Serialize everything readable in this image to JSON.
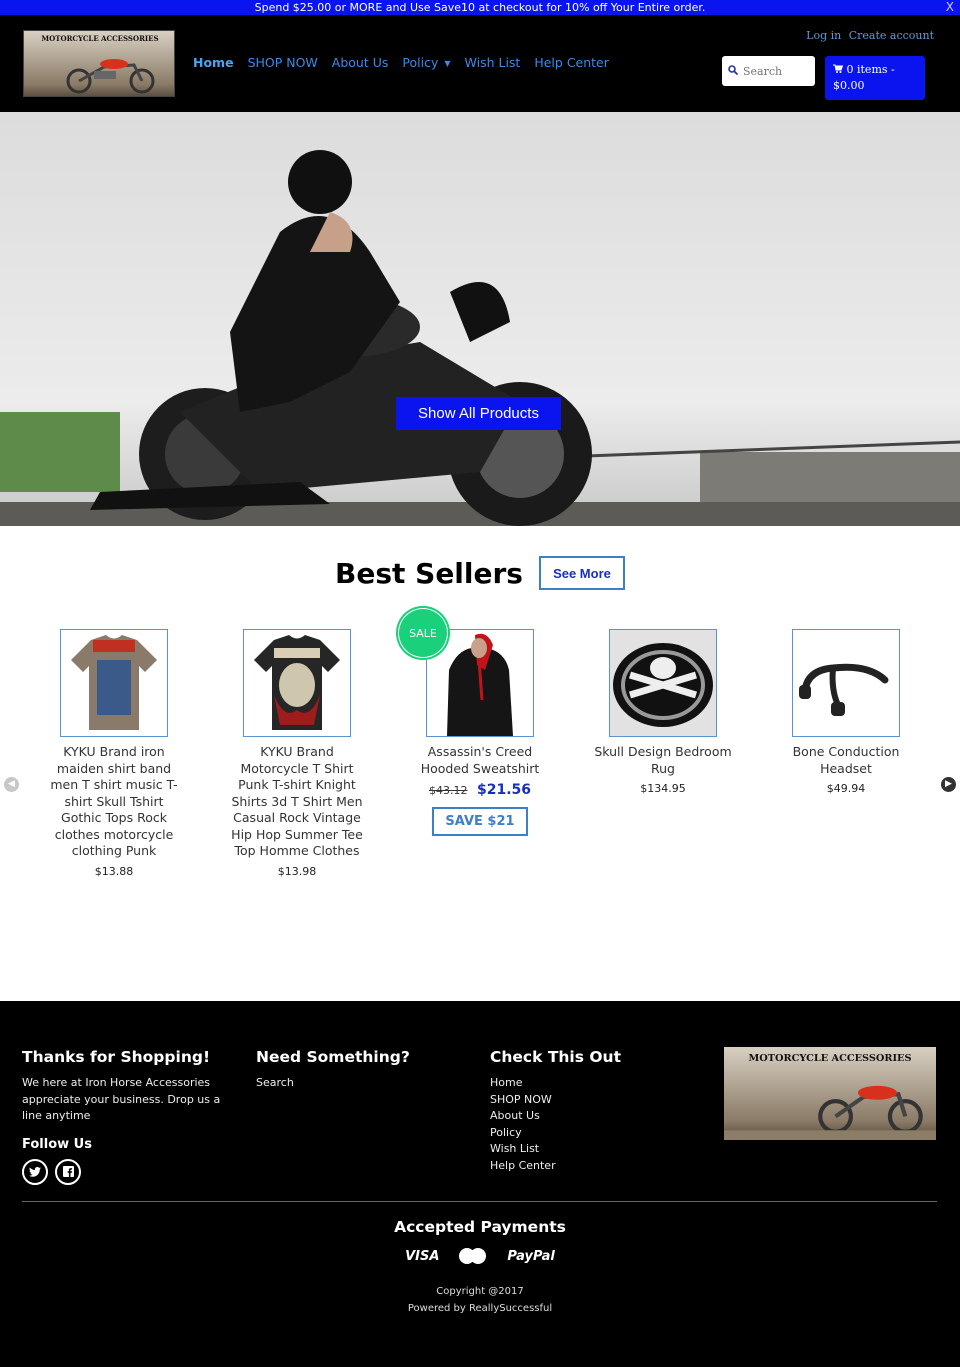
{
  "announcement": {
    "text": "Spend $25.00 or MORE and Use Save10 at checkout for 10% off Your Entire order.",
    "close": "X"
  },
  "header": {
    "logo_text": "Motorcycle Accessories",
    "nav": [
      {
        "label": "Home",
        "active": true
      },
      {
        "label": "SHOP NOW"
      },
      {
        "label": "About Us"
      },
      {
        "label": "Policy",
        "dropdown": true
      },
      {
        "label": "Wish List"
      },
      {
        "label": "Help Center"
      }
    ],
    "login": "Log in",
    "create_account": "Create account",
    "search_placeholder": "Search",
    "cart_label": "0 items - $0.00",
    "cart_icon": "cart-icon"
  },
  "hero": {
    "button": "Show All Products"
  },
  "best_sellers": {
    "title": "Best Sellers",
    "see_more": "See More",
    "products": [
      {
        "title": "KYKU Brand iron maiden shirt band men T shirt music T-shirt Skull Tshirt Gothic Tops Rock clothes motorcycle clothing Punk",
        "price": "$13.88"
      },
      {
        "title": "KYKU Brand Motorcycle T Shirt Punk T-shirt Knight Shirts 3d T Shirt Men Casual Rock Vintage Hip Hop Summer Tee Top Homme Clothes",
        "price": "$13.98"
      },
      {
        "title": "Assassin's Creed Hooded Sweatshirt",
        "old_price": "$43.12",
        "price": "$21.56",
        "badge": "SALE",
        "save": "SAVE $21"
      },
      {
        "title": "Skull Design Bedroom Rug",
        "price": "$134.95"
      },
      {
        "title": "Bone Conduction Headset",
        "price": "$49.94"
      }
    ],
    "prev_icon": "chevron-left-icon",
    "next_icon": "chevron-right-icon"
  },
  "footer": {
    "col1": {
      "title": "Thanks for Shopping!",
      "text": "We here at Iron Horse Accessories appreciate your business. Drop us a line anytime",
      "follow": "Follow Us",
      "social": [
        "t",
        "f"
      ]
    },
    "col2": {
      "title": "Need Something?",
      "links": [
        "Search"
      ]
    },
    "col3": {
      "title": "Check This Out",
      "links": [
        "Home",
        "SHOP NOW",
        "About Us",
        "Policy",
        "Wish List",
        "Help Center"
      ]
    },
    "payments": {
      "title": "Accepted Payments",
      "visa": "VISA",
      "mastercard": "MasterCard",
      "paypal": "PayPal"
    },
    "copyright": "Copyright @2017",
    "powered": "Powered by ReallySuccessful"
  }
}
